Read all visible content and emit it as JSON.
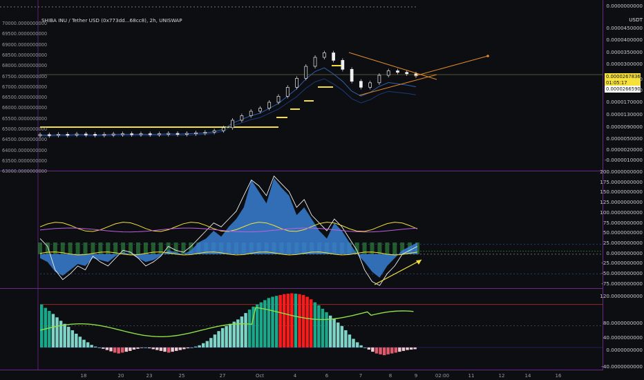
{
  "chart_title": "SHIBA INU / Tether USD (0x773dd...68cc8), 2h, UNISWAP",
  "currency_label": "USDT",
  "price_tag": {
    "price": "0.0000267836",
    "countdown": "01:05:17",
    "ref_price": "0.0000266590"
  },
  "colors": {
    "background": "#0d0e12",
    "pane_border": "#6b2a8a",
    "price_tag": "#f5e13a",
    "trend_line": "#e08a2e",
    "bar_up": "#7fd4c8",
    "bar_down": "#e05a6a",
    "highlight_bar": "#ff1a1a"
  },
  "chart_data": [
    {
      "type": "candlestick",
      "pane": "price",
      "left_axis_ticks": [
        "70000.0000000000",
        "69500.0000000000",
        "69000.0000000000",
        "68500.0000000000",
        "68000.0000000000",
        "67500.0000000000",
        "67000.0000000000",
        "66500.0000000000",
        "66000.0000000000",
        "65500.0000000000",
        "65000.0000000000",
        "64500.0000000000",
        "64000.0000000000",
        "63500.0000000000",
        "63000.0000000000"
      ],
      "right_axis_ticks": [
        "0.0000000000",
        "0.0000000500",
        "0.0000450000",
        "0.0000400000",
        "0.0000350000",
        "0.0000300000",
        "0.0000250000",
        "0.0000210000",
        "0.0000170000",
        "0.0000130000",
        "0.0000090000",
        "0.0000050000",
        "0.0000020000",
        "-0.0000010000"
      ],
      "x_ticks": [
        "18",
        "20",
        "23",
        "25",
        "27",
        "Oct",
        "4",
        "6",
        "7",
        "8",
        "9",
        "02:00",
        "11",
        "12",
        "14",
        "16"
      ],
      "close_series_usd": [
        7.2e-06,
        7.1e-06,
        7.3e-06,
        7.2e-06,
        7.4e-06,
        7.3e-06,
        7.2e-06,
        7.3e-06,
        7.4e-06,
        7.5e-06,
        7.4e-06,
        7.5e-06,
        7.4e-06,
        7.5e-06,
        7.6e-06,
        7.5e-06,
        7.6e-06,
        7.8e-06,
        8e-06,
        8.5e-06,
        9.5e-06,
        1.2e-05,
        1.35e-05,
        1.5e-05,
        1.6e-05,
        1.8e-05,
        2e-05,
        2.3e-05,
        2.6e-05,
        3e-05,
        3.3e-05,
        3.45e-05,
        3.2e-05,
        2.9e-05,
        2.5e-05,
        2.3e-05,
        2.45e-05,
        2.7e-05,
        2.85e-05,
        2.8e-05,
        2.75e-05,
        2.68e-05
      ]
    },
    {
      "type": "oscillator",
      "pane": "momentum",
      "right_axis_ticks": [
        "200.0000000000",
        "175.0000000000",
        "150.0000000000",
        "125.0000000000",
        "100.0000000000",
        "75.0000000000",
        "50.0000000000",
        "25.0000000000",
        "0.0000000000",
        "-25.0000000000",
        "-50.0000000000",
        "-75.0000000000"
      ],
      "ylim": [
        -85,
        205
      ],
      "wave_values": [
        -10,
        -20,
        -45,
        -55,
        -40,
        -25,
        -30,
        -10,
        -15,
        -20,
        -5,
        5,
        0,
        -10,
        -20,
        -15,
        -5,
        10,
        5,
        0,
        10,
        30,
        40,
        60,
        45,
        70,
        90,
        120,
        190,
        160,
        130,
        195,
        170,
        150,
        100,
        120,
        90,
        60,
        40,
        80,
        60,
        30,
        0,
        -20,
        -45,
        -60,
        -30,
        -10,
        10,
        20,
        30
      ],
      "signal_values": [
        40,
        20,
        -40,
        -65,
        -50,
        -30,
        -40,
        -5,
        -20,
        -30,
        -10,
        10,
        5,
        -10,
        -30,
        -20,
        -5,
        20,
        10,
        5,
        20,
        40,
        60,
        80,
        70,
        90,
        110,
        150,
        190,
        175,
        150,
        200,
        180,
        160,
        120,
        140,
        100,
        80,
        60,
        90,
        70,
        40,
        10,
        -40,
        -70,
        -80,
        -50,
        -30,
        0,
        10,
        20
      ]
    },
    {
      "type": "histogram",
      "pane": "strength",
      "right_axis_ticks": [
        "120.0000000000",
        "80.0000000000",
        "40.0000000000",
        "0.0000000000",
        "-40.0000000000"
      ],
      "ylim": [
        -50,
        130
      ],
      "values": [
        100,
        92,
        85,
        78,
        70,
        62,
        55,
        48,
        40,
        32,
        25,
        18,
        12,
        6,
        2,
        0,
        -3,
        -6,
        -9,
        -12,
        -14,
        -12,
        -10,
        -8,
        -5,
        -3,
        -1,
        0,
        -2,
        -4,
        -6,
        -8,
        -10,
        -12,
        -10,
        -8,
        -6,
        -4,
        -2,
        0,
        2,
        5,
        10,
        15,
        22,
        30,
        38,
        45,
        50,
        55,
        60,
        65,
        72,
        80,
        88,
        95,
        100,
        105,
        110,
        115,
        118,
        120,
        122,
        124,
        125,
        126,
        125,
        124,
        122,
        118,
        112,
        105,
        98,
        90,
        82,
        74,
        66,
        58,
        50,
        40,
        30,
        20,
        12,
        5,
        0,
        -5,
        -10,
        -14,
        -16,
        -18,
        -16,
        -14,
        -12,
        -10,
        -8,
        -6,
        -5,
        -4
      ]
    }
  ]
}
